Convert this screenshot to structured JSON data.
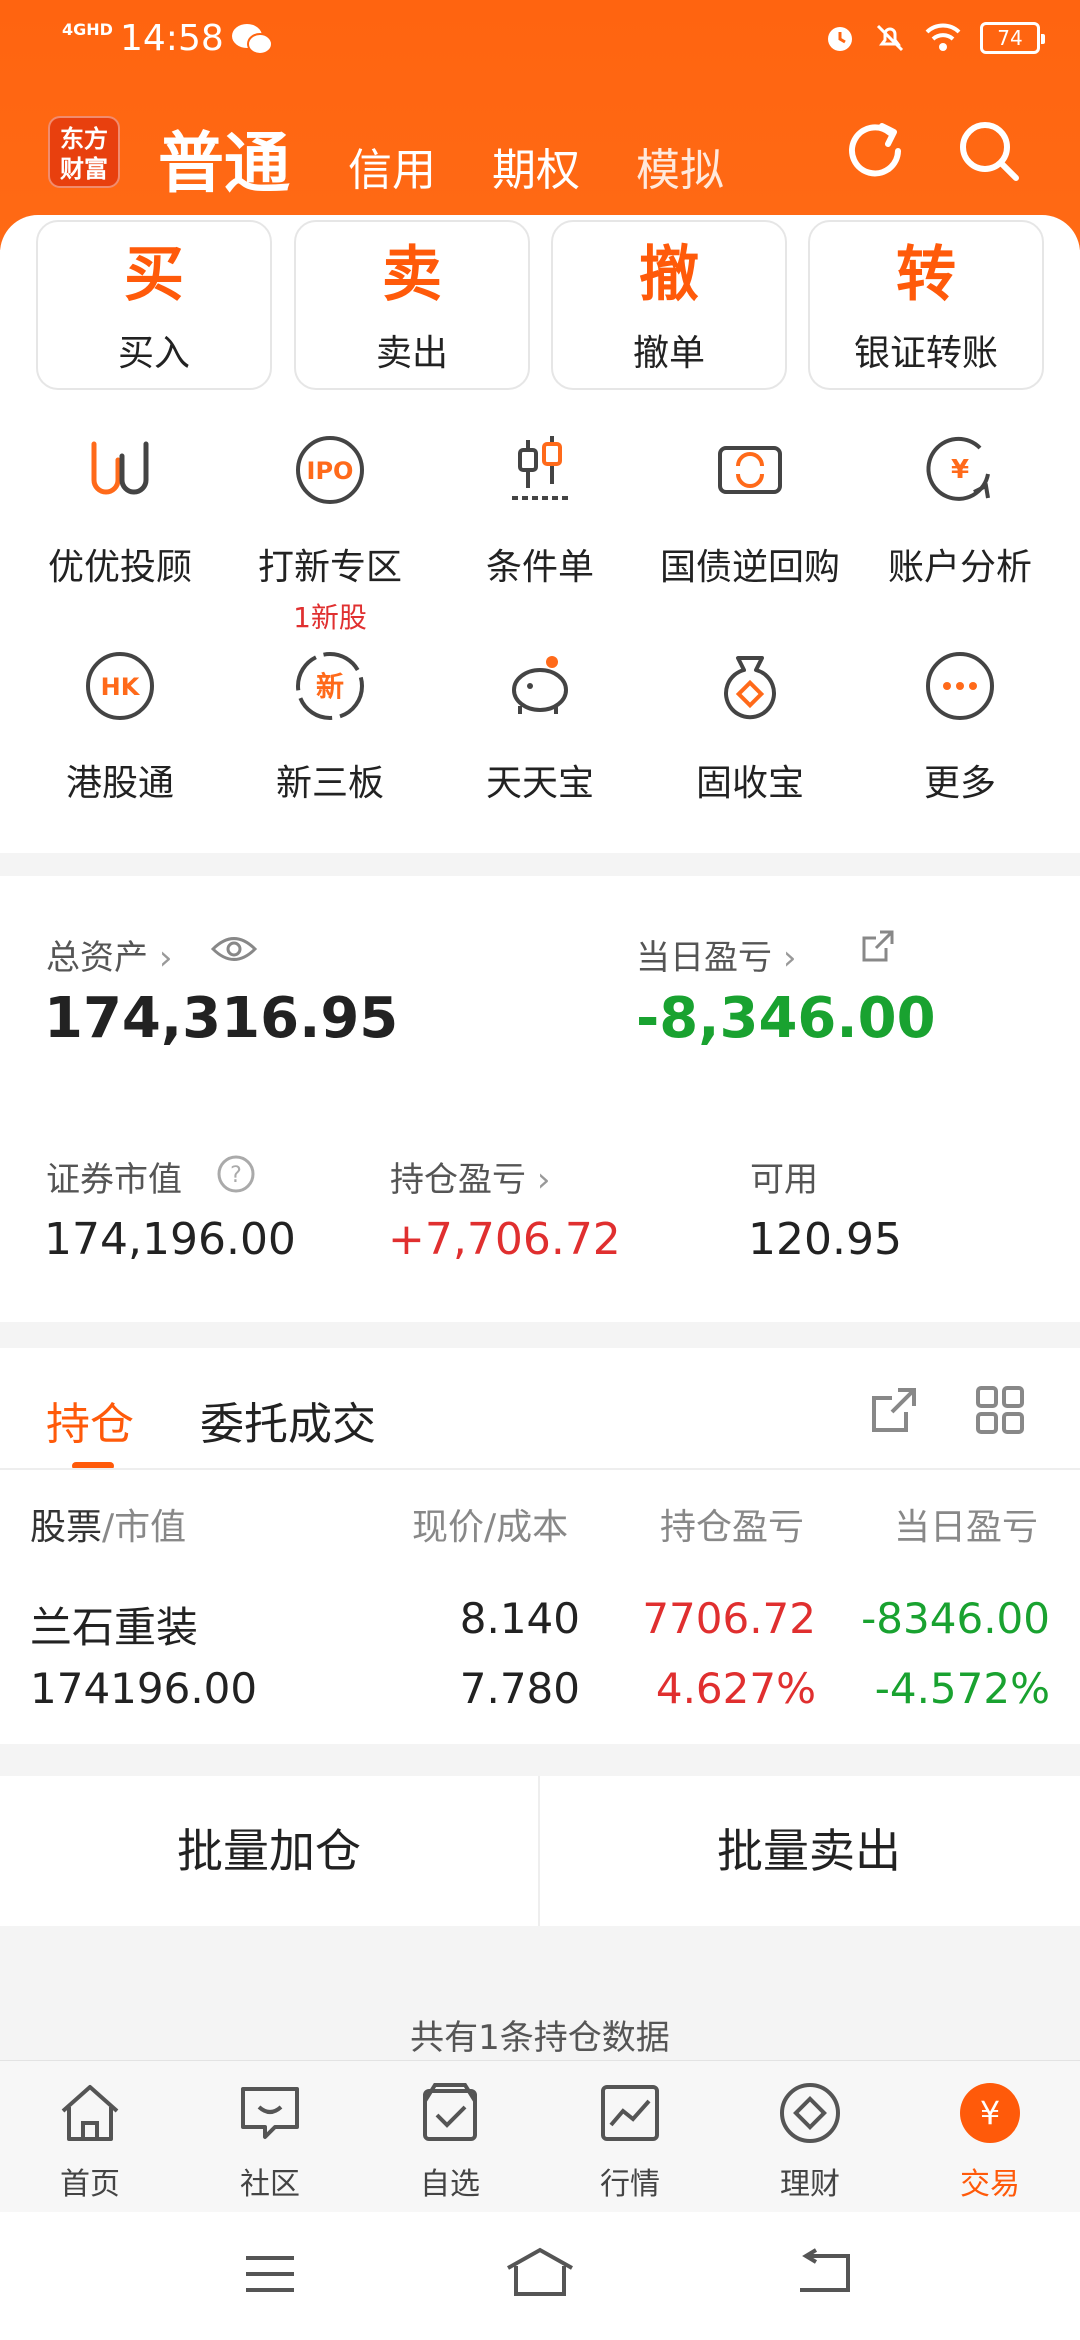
{
  "status": {
    "network": "4GHD",
    "time": "14:58",
    "battery": "74"
  },
  "nav": {
    "logo": [
      "东方",
      "财富"
    ],
    "active_tab": "普通",
    "tabs": [
      "信用",
      "期权",
      "模拟"
    ]
  },
  "quick_actions": [
    {
      "glyph": "买",
      "label": "买入"
    },
    {
      "glyph": "卖",
      "label": "卖出"
    },
    {
      "glyph": "撤",
      "label": "撤单"
    },
    {
      "glyph": "转",
      "label": "银证转账"
    }
  ],
  "services": [
    {
      "label": "优优投顾",
      "icon": "uu-advisor-icon"
    },
    {
      "label": "打新专区",
      "icon": "ipo-icon",
      "sub": "1新股",
      "icon_text": "IPO"
    },
    {
      "label": "条件单",
      "icon": "condition-order-icon"
    },
    {
      "label": "国债逆回购",
      "icon": "bond-repo-icon"
    },
    {
      "label": "账户分析",
      "icon": "account-analysis-icon",
      "icon_text": "¥"
    },
    {
      "label": "港股通",
      "icon": "hk-connect-icon",
      "icon_text": "HK"
    },
    {
      "label": "新三板",
      "icon": "neeq-icon",
      "icon_text": "新"
    },
    {
      "label": "天天宝",
      "icon": "piggy-bank-icon"
    },
    {
      "label": "固收宝",
      "icon": "money-bag-icon"
    },
    {
      "label": "更多",
      "icon": "more-icon"
    }
  ],
  "assets": {
    "total_label": "总资产",
    "total_value": "174,316.95",
    "daily_label": "当日盈亏",
    "daily_value": "-8,346.00",
    "market_label": "证券市值",
    "market_value": "174,196.00",
    "position_pl_label": "持仓盈亏",
    "position_pl_value": "+7,706.72",
    "available_label": "可用",
    "available_value": "120.95"
  },
  "holdings": {
    "tabs": [
      "持仓",
      "委托成交"
    ],
    "headers": {
      "stock": "股票",
      "market_value": "/市值",
      "price": "现价/成本",
      "position_pl": "持仓盈亏",
      "daily_pl": "当日盈亏"
    },
    "rows": [
      {
        "name": "兰石重装",
        "market_value": "174196.00",
        "price": "8.140",
        "cost": "7.780",
        "pl": "7706.72",
        "pl_pct": "4.627%",
        "daily": "-8346.00",
        "daily_pct": "-4.572%"
      }
    ]
  },
  "batch": {
    "add": "批量加仓",
    "sell": "批量卖出"
  },
  "footer_note": "共有1条持仓数据",
  "tabbar": [
    {
      "label": "首页",
      "icon": "home-icon"
    },
    {
      "label": "社区",
      "icon": "community-icon"
    },
    {
      "label": "自选",
      "icon": "watchlist-icon"
    },
    {
      "label": "行情",
      "icon": "market-icon"
    },
    {
      "label": "理财",
      "icon": "wealth-icon"
    },
    {
      "label": "交易",
      "icon": "trade-icon",
      "active": true,
      "icon_text": "¥"
    }
  ],
  "colors": {
    "brand": "#ff6410",
    "up": "#e02f2f",
    "down": "#19a230"
  }
}
